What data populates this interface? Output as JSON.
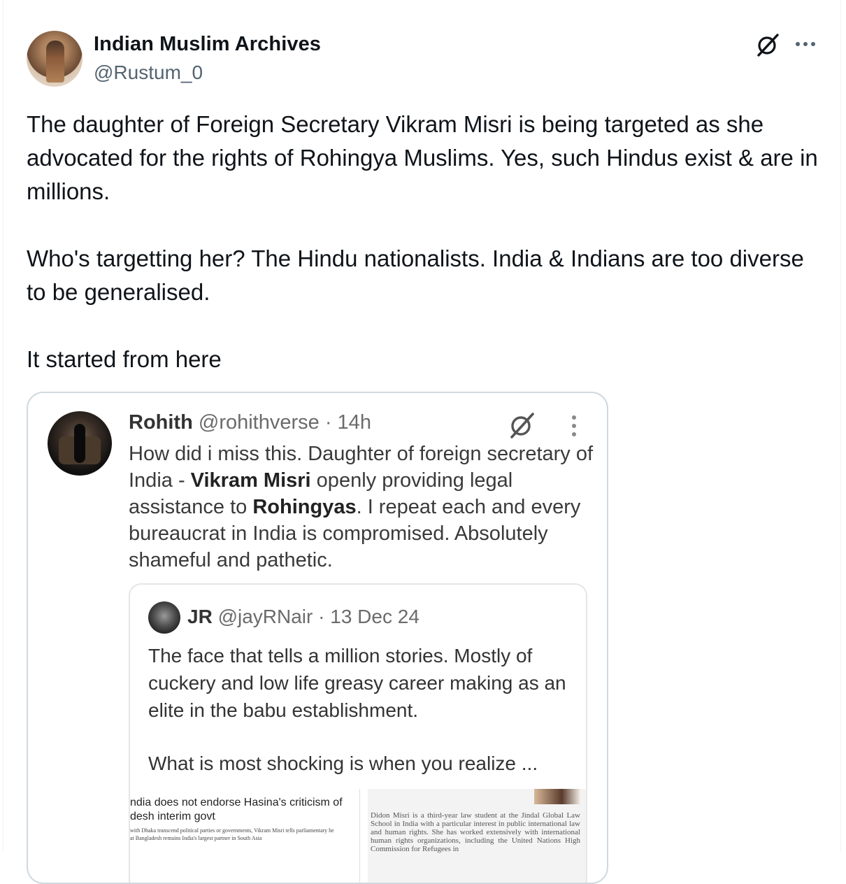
{
  "post": {
    "display_name": "Indian Muslim Archives",
    "handle": "@Rustum_0",
    "text_p1": "The daughter of Foreign Secretary Vikram Misri is being targeted as she advocated for the rights of Rohingya Muslims. Yes, such Hindus exist & are in millions.",
    "text_p2": "Who's targetting her? The Hindu nationalists. India & Indians are too diverse to be generalised.",
    "text_p3": "It started from here"
  },
  "icons": {
    "grok": "grok-icon",
    "more": "more-horizontal-icon"
  },
  "screenshot": {
    "rohith": {
      "name": "Rohith",
      "handle": "@rohithverse",
      "time": "· 14h",
      "body_parts": [
        "How did i miss this. Daughter of foreign secretary of India - ",
        "Vikram Misri",
        " openly providing legal assistance to ",
        "Rohingyas",
        ". I repeat each and every bureaucrat in India is compromised. Absolutely shameful and pathetic."
      ]
    },
    "quote": {
      "name": "JR",
      "handle": "@jayRNair",
      "time": "· 13 Dec 24",
      "body": "The face that tells a million stories. Mostly of cuckery and low life greasy career making as an elite in the babu establishment.",
      "body2": "What is most shocking is when you realize ..."
    },
    "news_left": {
      "headline": "ndia does not endorse Hasina's criticism of\ndesh interim govt",
      "small": "with Dhaka transcend political parties or governments, Vikram Misri tells parliamentary he\nat Bangladesh remains India's largest partner in South Asia"
    },
    "news_right": {
      "para": "Didon Misri is a third-year law student at the Jindal Global Law School in India with a particular interest in public international law and human rights. She has worked extensively with international human rights organizations, including the United Nations High Commission for Refugees in"
    }
  }
}
